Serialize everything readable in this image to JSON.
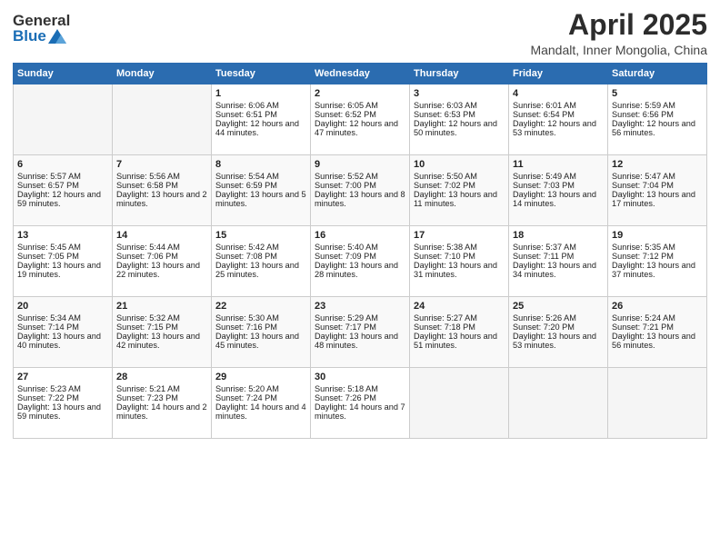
{
  "header": {
    "logo_general": "General",
    "logo_blue": "Blue",
    "title": "April 2025",
    "subtitle": "Mandalt, Inner Mongolia, China"
  },
  "weekdays": [
    "Sunday",
    "Monday",
    "Tuesday",
    "Wednesday",
    "Thursday",
    "Friday",
    "Saturday"
  ],
  "weeks": [
    [
      {
        "day": "",
        "sunrise": "",
        "sunset": "",
        "daylight": ""
      },
      {
        "day": "",
        "sunrise": "",
        "sunset": "",
        "daylight": ""
      },
      {
        "day": "1",
        "sunrise": "Sunrise: 6:06 AM",
        "sunset": "Sunset: 6:51 PM",
        "daylight": "Daylight: 12 hours and 44 minutes."
      },
      {
        "day": "2",
        "sunrise": "Sunrise: 6:05 AM",
        "sunset": "Sunset: 6:52 PM",
        "daylight": "Daylight: 12 hours and 47 minutes."
      },
      {
        "day": "3",
        "sunrise": "Sunrise: 6:03 AM",
        "sunset": "Sunset: 6:53 PM",
        "daylight": "Daylight: 12 hours and 50 minutes."
      },
      {
        "day": "4",
        "sunrise": "Sunrise: 6:01 AM",
        "sunset": "Sunset: 6:54 PM",
        "daylight": "Daylight: 12 hours and 53 minutes."
      },
      {
        "day": "5",
        "sunrise": "Sunrise: 5:59 AM",
        "sunset": "Sunset: 6:56 PM",
        "daylight": "Daylight: 12 hours and 56 minutes."
      }
    ],
    [
      {
        "day": "6",
        "sunrise": "Sunrise: 5:57 AM",
        "sunset": "Sunset: 6:57 PM",
        "daylight": "Daylight: 12 hours and 59 minutes."
      },
      {
        "day": "7",
        "sunrise": "Sunrise: 5:56 AM",
        "sunset": "Sunset: 6:58 PM",
        "daylight": "Daylight: 13 hours and 2 minutes."
      },
      {
        "day": "8",
        "sunrise": "Sunrise: 5:54 AM",
        "sunset": "Sunset: 6:59 PM",
        "daylight": "Daylight: 13 hours and 5 minutes."
      },
      {
        "day": "9",
        "sunrise": "Sunrise: 5:52 AM",
        "sunset": "Sunset: 7:00 PM",
        "daylight": "Daylight: 13 hours and 8 minutes."
      },
      {
        "day": "10",
        "sunrise": "Sunrise: 5:50 AM",
        "sunset": "Sunset: 7:02 PM",
        "daylight": "Daylight: 13 hours and 11 minutes."
      },
      {
        "day": "11",
        "sunrise": "Sunrise: 5:49 AM",
        "sunset": "Sunset: 7:03 PM",
        "daylight": "Daylight: 13 hours and 14 minutes."
      },
      {
        "day": "12",
        "sunrise": "Sunrise: 5:47 AM",
        "sunset": "Sunset: 7:04 PM",
        "daylight": "Daylight: 13 hours and 17 minutes."
      }
    ],
    [
      {
        "day": "13",
        "sunrise": "Sunrise: 5:45 AM",
        "sunset": "Sunset: 7:05 PM",
        "daylight": "Daylight: 13 hours and 19 minutes."
      },
      {
        "day": "14",
        "sunrise": "Sunrise: 5:44 AM",
        "sunset": "Sunset: 7:06 PM",
        "daylight": "Daylight: 13 hours and 22 minutes."
      },
      {
        "day": "15",
        "sunrise": "Sunrise: 5:42 AM",
        "sunset": "Sunset: 7:08 PM",
        "daylight": "Daylight: 13 hours and 25 minutes."
      },
      {
        "day": "16",
        "sunrise": "Sunrise: 5:40 AM",
        "sunset": "Sunset: 7:09 PM",
        "daylight": "Daylight: 13 hours and 28 minutes."
      },
      {
        "day": "17",
        "sunrise": "Sunrise: 5:38 AM",
        "sunset": "Sunset: 7:10 PM",
        "daylight": "Daylight: 13 hours and 31 minutes."
      },
      {
        "day": "18",
        "sunrise": "Sunrise: 5:37 AM",
        "sunset": "Sunset: 7:11 PM",
        "daylight": "Daylight: 13 hours and 34 minutes."
      },
      {
        "day": "19",
        "sunrise": "Sunrise: 5:35 AM",
        "sunset": "Sunset: 7:12 PM",
        "daylight": "Daylight: 13 hours and 37 minutes."
      }
    ],
    [
      {
        "day": "20",
        "sunrise": "Sunrise: 5:34 AM",
        "sunset": "Sunset: 7:14 PM",
        "daylight": "Daylight: 13 hours and 40 minutes."
      },
      {
        "day": "21",
        "sunrise": "Sunrise: 5:32 AM",
        "sunset": "Sunset: 7:15 PM",
        "daylight": "Daylight: 13 hours and 42 minutes."
      },
      {
        "day": "22",
        "sunrise": "Sunrise: 5:30 AM",
        "sunset": "Sunset: 7:16 PM",
        "daylight": "Daylight: 13 hours and 45 minutes."
      },
      {
        "day": "23",
        "sunrise": "Sunrise: 5:29 AM",
        "sunset": "Sunset: 7:17 PM",
        "daylight": "Daylight: 13 hours and 48 minutes."
      },
      {
        "day": "24",
        "sunrise": "Sunrise: 5:27 AM",
        "sunset": "Sunset: 7:18 PM",
        "daylight": "Daylight: 13 hours and 51 minutes."
      },
      {
        "day": "25",
        "sunrise": "Sunrise: 5:26 AM",
        "sunset": "Sunset: 7:20 PM",
        "daylight": "Daylight: 13 hours and 53 minutes."
      },
      {
        "day": "26",
        "sunrise": "Sunrise: 5:24 AM",
        "sunset": "Sunset: 7:21 PM",
        "daylight": "Daylight: 13 hours and 56 minutes."
      }
    ],
    [
      {
        "day": "27",
        "sunrise": "Sunrise: 5:23 AM",
        "sunset": "Sunset: 7:22 PM",
        "daylight": "Daylight: 13 hours and 59 minutes."
      },
      {
        "day": "28",
        "sunrise": "Sunrise: 5:21 AM",
        "sunset": "Sunset: 7:23 PM",
        "daylight": "Daylight: 14 hours and 2 minutes."
      },
      {
        "day": "29",
        "sunrise": "Sunrise: 5:20 AM",
        "sunset": "Sunset: 7:24 PM",
        "daylight": "Daylight: 14 hours and 4 minutes."
      },
      {
        "day": "30",
        "sunrise": "Sunrise: 5:18 AM",
        "sunset": "Sunset: 7:26 PM",
        "daylight": "Daylight: 14 hours and 7 minutes."
      },
      {
        "day": "",
        "sunrise": "",
        "sunset": "",
        "daylight": ""
      },
      {
        "day": "",
        "sunrise": "",
        "sunset": "",
        "daylight": ""
      },
      {
        "day": "",
        "sunrise": "",
        "sunset": "",
        "daylight": ""
      }
    ]
  ]
}
